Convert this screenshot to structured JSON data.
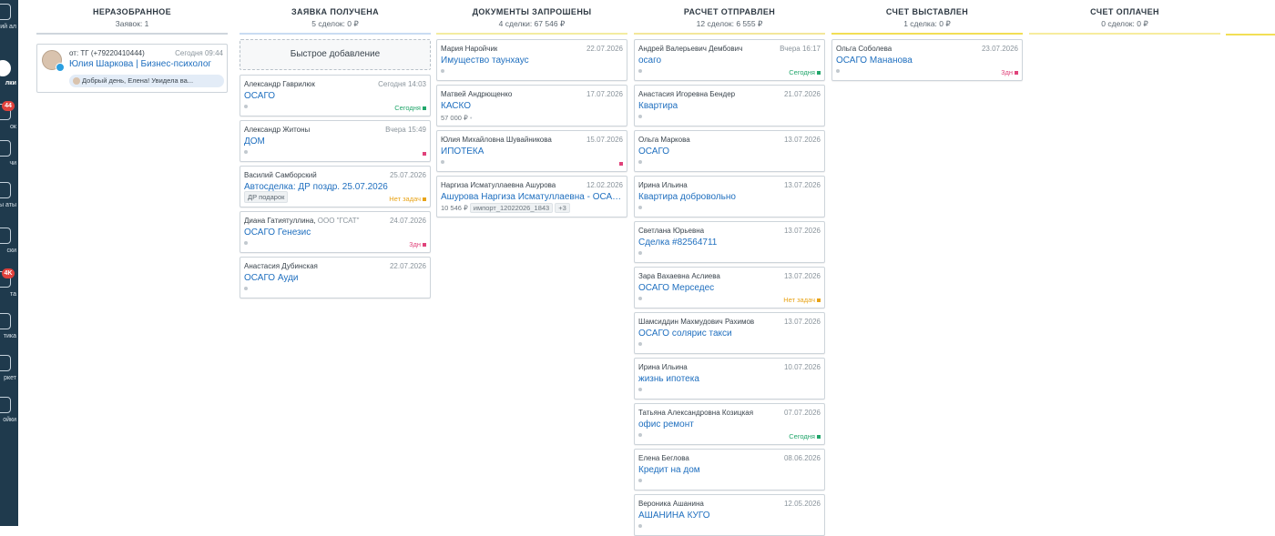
{
  "sidebar": {
    "items": [
      {
        "label": "чий\nал",
        "label_short": "ал",
        "icon": "chat-icon",
        "badge": ""
      },
      {
        "label": "лки",
        "icon": "pipeline-icon",
        "badge": "",
        "active": true
      },
      {
        "label": "ок",
        "icon": "list-icon",
        "badge": "44"
      },
      {
        "label": "чи",
        "icon": "tasks-icon",
        "badge": ""
      },
      {
        "label": "енты\nаты",
        "icon": "contacts-icon",
        "badge": ""
      },
      {
        "label": "ски",
        "icon": "lists-icon",
        "badge": ""
      },
      {
        "label": "та",
        "icon": "mail-icon",
        "badge": "4K"
      },
      {
        "label": "тика",
        "icon": "analytics-icon",
        "badge": ""
      },
      {
        "label": "ркет",
        "icon": "market-icon",
        "badge": ""
      },
      {
        "label": "ойки",
        "icon": "settings-icon",
        "badge": ""
      }
    ]
  },
  "colors": {
    "status_today": "#21a66b",
    "status_overdue": "#e0427a",
    "status_no_tasks": "#e8a317",
    "link": "#1f6fbf"
  },
  "columns": [
    {
      "title": "НЕРАЗОБРАННОЕ",
      "subtitle": "Заявок: 1",
      "color": "#cfd6dd",
      "lead": {
        "from": "от: ТГ (+79220410444)",
        "date": "Сегодня 09:44",
        "name": "Юлия Шаркова | Бизнес-психолог",
        "message": "Добрый день, Елена! Увидела ва..."
      },
      "cards": []
    },
    {
      "title": "ЗАЯВКА ПОЛУЧЕНА",
      "subtitle": "5 сделок: 0 ₽",
      "color": "#c9dcf2",
      "quick_add": "Быстрое добавление",
      "cards": [
        {
          "name": "Александр Гаврилюк",
          "date": "Сегодня 14:03",
          "title": "ОСАГО",
          "status": "Сегодня",
          "status_type": "today"
        },
        {
          "name": "Александр Житоны",
          "date": "Вчера 15:49",
          "title": "ДОМ",
          "status": "",
          "status_type": "overdue"
        },
        {
          "name": "Василий Самборский",
          "date": "25.07.2026",
          "title": "Автосделка: ДР поздр. 25.07.2026",
          "tag": "ДР подарок",
          "status": "Нет задач",
          "status_type": "no_tasks"
        },
        {
          "name": "Диана Гатиятуллина,",
          "org": "ООО \"ГСАТ\"",
          "date": "24.07.2026",
          "title": "ОСАГО Генезис",
          "status": "3дн",
          "status_type": "overdue"
        },
        {
          "name": "Анастасия Дубинская",
          "date": "22.07.2026",
          "title": "ОСАГО Ауди",
          "status": "",
          "status_type": ""
        }
      ]
    },
    {
      "title": "ДОКУМЕНТЫ ЗАПРОШЕНЫ",
      "subtitle": "4 сделки: 67 546 ₽",
      "color": "#f3eca0",
      "cards": [
        {
          "name": "Мария Наройчик",
          "date": "22.07.2026",
          "title": "Имущество таунхаус",
          "status": "",
          "status_type": ""
        },
        {
          "name": "Матвей Андрющенко",
          "date": "17.07.2026",
          "title": "КАСКО",
          "meta": "57 000 ₽",
          "status": "",
          "status_type": ""
        },
        {
          "name": "Юлия Михайловна Шувайникова",
          "date": "15.07.2026",
          "title": "ИПОТЕКА",
          "status": "",
          "status_type": "overdue"
        },
        {
          "name": "Наргиза Исматуллаевна Ашурова",
          "date": "12.02.2026",
          "title": "Ашурова Наргиза Исматуллаевна - ОСАГО д...",
          "meta": "10 546 ₽",
          "chip": "импорт_12022026_1843",
          "chip2": "+3",
          "status": "",
          "status_type": ""
        }
      ]
    },
    {
      "title": "РАСЧЕТ ОТПРАВЛЕН",
      "subtitle": "12 сделок: 6 555 ₽",
      "color": "#f3e79a",
      "cards": [
        {
          "name": "Андрей Валерьевич Дембович",
          "date": "Вчера 16:17",
          "title": "осаго",
          "status": "Сегодня",
          "status_type": "today"
        },
        {
          "name": "Анастасия Игоревна Бендер",
          "date": "21.07.2026",
          "title": "Квартира",
          "status": "",
          "status_type": ""
        },
        {
          "name": "Ольга Маркова",
          "date": "13.07.2026",
          "title": "ОСАГО",
          "status": "",
          "status_type": ""
        },
        {
          "name": "Ирина Ильина",
          "date": "13.07.2026",
          "title": "Квартира добровольно",
          "status": "",
          "status_type": ""
        },
        {
          "name": "Светлана Юрьевна",
          "date": "13.07.2026",
          "title": "Сделка #82564711",
          "status": "",
          "status_type": ""
        },
        {
          "name": "Зара Вахаевна Аслиева",
          "date": "13.07.2026",
          "title": "ОСАГО Мерседес",
          "status": "Нет задач",
          "status_type": "no_tasks"
        },
        {
          "name": "Шамсиддин Махмудович Рахимов",
          "date": "13.07.2026",
          "title": "ОСАГО солярис такси",
          "status": "",
          "status_type": ""
        },
        {
          "name": "Ирина Ильина",
          "date": "10.07.2026",
          "title": "жизнь ипотека",
          "status": "",
          "status_type": ""
        },
        {
          "name": "Татьяна Александровна Козицкая",
          "date": "07.07.2026",
          "title": "офис ремонт",
          "status": "Сегодня",
          "status_type": "today"
        },
        {
          "name": "Елена Беглова",
          "date": "08.06.2026",
          "title": "Кредит на дом",
          "status": "",
          "status_type": ""
        },
        {
          "name": "Вероника Ашанина",
          "date": "12.05.2026",
          "title": "АШАНИНА КУГО",
          "status": "",
          "status_type": ""
        }
      ]
    },
    {
      "title": "СЧЕТ ВЫСТАВЛЕН",
      "subtitle": "1 сделка: 0 ₽",
      "color": "#f2df55",
      "cards": [
        {
          "name": "Ольга Соболева",
          "date": "23.07.2026",
          "title": "ОСАГО Мананова",
          "status": "3дн",
          "status_type": "overdue"
        }
      ]
    },
    {
      "title": "СЧЕТ ОПЛАЧЕН",
      "subtitle": "0 сделок: 0 ₽",
      "color": "#f7ec9e",
      "cards": []
    }
  ]
}
